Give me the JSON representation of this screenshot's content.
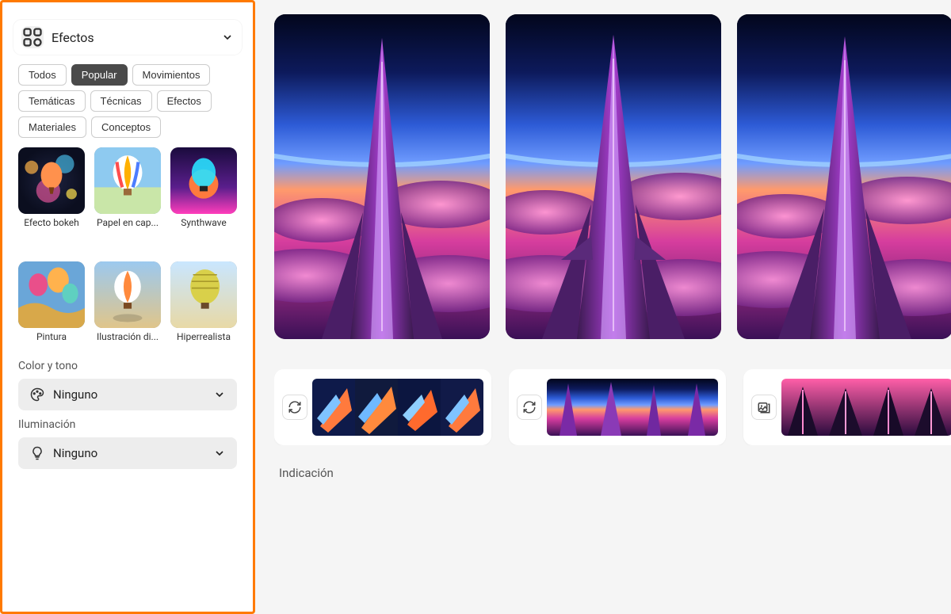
{
  "sidebar": {
    "effects": {
      "title": "Efectos",
      "filters": [
        {
          "label": "Todos",
          "active": false
        },
        {
          "label": "Popular",
          "active": true
        },
        {
          "label": "Movimientos",
          "active": false
        },
        {
          "label": "Temáticas",
          "active": false
        },
        {
          "label": "Técnicas",
          "active": false
        },
        {
          "label": "Efectos",
          "active": false
        },
        {
          "label": "Materiales",
          "active": false
        },
        {
          "label": "Conceptos",
          "active": false
        }
      ],
      "items": [
        {
          "label": "Efecto bokeh",
          "thumb_style": "bokeh"
        },
        {
          "label": "Papel en cap...",
          "thumb_style": "paper"
        },
        {
          "label": "Synthwave",
          "thumb_style": "synth"
        },
        {
          "label": "Pintura",
          "thumb_style": "paint"
        },
        {
          "label": "Ilustración di...",
          "thumb_style": "illus"
        },
        {
          "label": "Hiperrealista",
          "thumb_style": "hyper"
        }
      ]
    },
    "color_tone": {
      "heading": "Color y tono",
      "value": "Ninguno"
    },
    "lighting": {
      "heading": "Iluminación",
      "value": "Ninguno"
    }
  },
  "main": {
    "generations": [
      {
        "style": "spaceship"
      },
      {
        "style": "spaceship"
      },
      {
        "style": "spaceship"
      }
    ],
    "history": [
      {
        "action_icon": "regen",
        "thumbs": [
          "ship-diag",
          "ship-diag",
          "ship-diag",
          "ship-diag"
        ]
      },
      {
        "action_icon": "regen",
        "thumbs": [
          "planet",
          "planet",
          "planet",
          "planet"
        ]
      },
      {
        "action_icon": "image",
        "thumbs": [
          "road",
          "road",
          "road",
          "road"
        ]
      }
    ],
    "prompt_label": "Indicación"
  },
  "colors": {
    "accent_frame": "#ff7a00",
    "chip_active_bg": "#4a4a4a"
  }
}
